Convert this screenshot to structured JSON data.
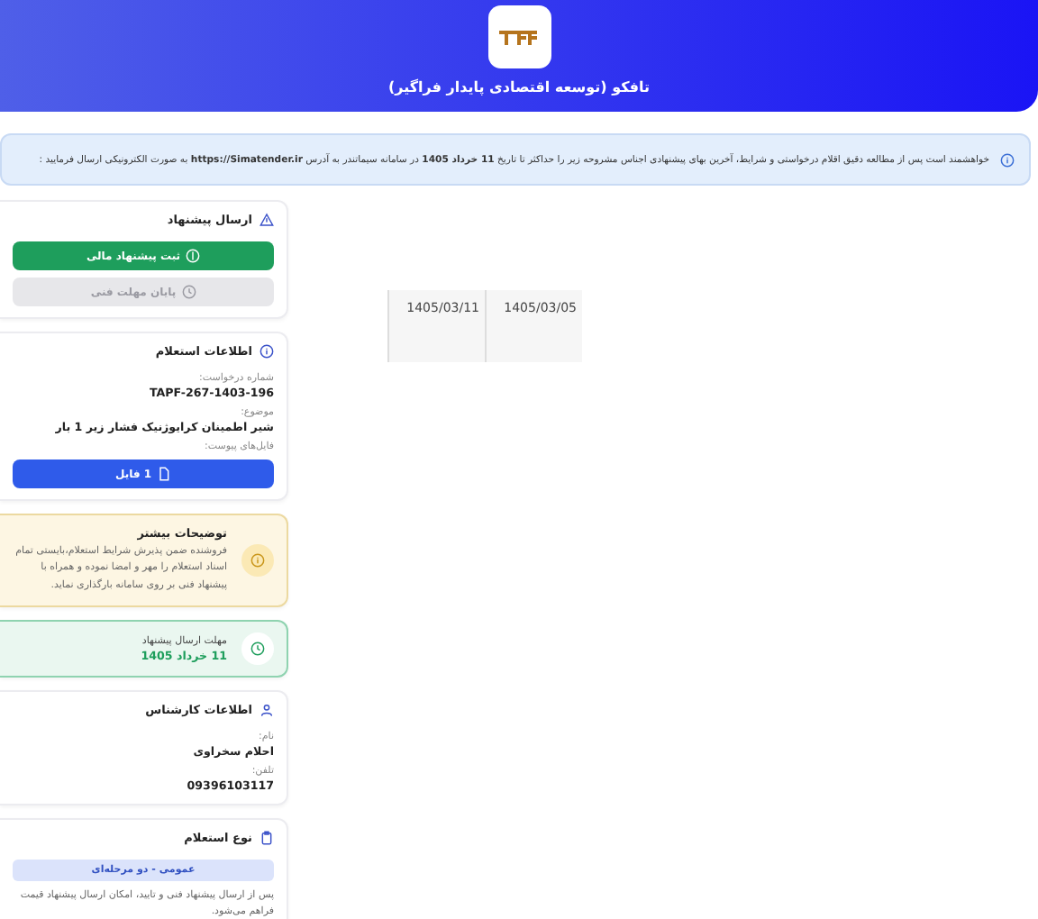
{
  "header": {
    "title": "تافکو (توسعه اقتصادی پایدار فراگیر)"
  },
  "notice": {
    "text": "خواهشمند است پس از مطالعه دقیق اقلام درخواستی و شرایط، آخرین بهای پیشنهادی اجناس مشروحه زیر را حداکثر تا تاریخ **11 خرداد 1405** در سامانه سیماتندر به آدرس **https://Simatender.ir** به صورت الکترونیکی ارسال فرمایید :"
  },
  "submit_card": {
    "title": "ارسال پیشنهاد",
    "buttons": [
      {
        "label": "ثبت پیشنهاد مالی",
        "kind": "primary",
        "disabled": false
      },
      {
        "label": "پایان مهلت فنی",
        "kind": "technical",
        "disabled": true
      }
    ]
  },
  "inquiry_card": {
    "title": "اطلاعات استعلام",
    "fields": [
      {
        "label": "شماره درخواست:",
        "value": "TAPF-267-1403-196"
      },
      {
        "label": "موضوع:",
        "value": "شیر اطمینان کرایوژنیک فشار زیر 1 بار"
      }
    ],
    "attachments_label": "فایل‌های پیوست:",
    "attachments_button": "1 فایل"
  },
  "notes_card": {
    "title": "توضیحات بیشتر",
    "text": "فروشنده ضمن پذیرش شرایط استعلام،بایستی تمام اسناد استعلام را مهر و امضا نموده و همراه با پیشنهاد فنی بر روی سامانه بارگذاری نماید."
  },
  "deadline_card": {
    "title": "مهلت ارسال پیشنهاد",
    "date": "11 خرداد 1405"
  },
  "expert_card": {
    "title": "اطلاعات کارشناس",
    "fields": [
      {
        "label": "نام:",
        "value": "احلام سخراوی"
      },
      {
        "label": "تلفن:",
        "value": "09396103117"
      }
    ]
  },
  "type_card": {
    "title": "نوع استعلام",
    "badge": "عمومی - دو مرحله‌ای",
    "text": "پس از ارسال پیشنهاد فنی و تایید، امکان ارسال پیشنهاد قیمت فراهم می‌شود."
  },
  "dates": [
    "1405/03/05",
    "1405/03/11"
  ]
}
